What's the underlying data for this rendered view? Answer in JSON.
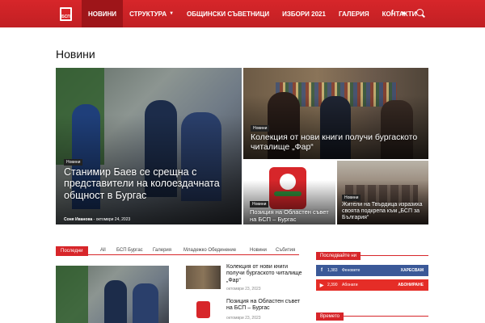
{
  "header": {
    "nav": [
      {
        "label": "НОВИНИ",
        "active": true
      },
      {
        "label": "СТРУКТУРА",
        "dropdown": true
      },
      {
        "label": "ОБЩИНСКИ СЪВЕТНИЦИ"
      },
      {
        "label": "ИЗБОРИ 2021"
      },
      {
        "label": "ГАЛЕРИЯ"
      },
      {
        "label": "КОНТАКТИ"
      }
    ],
    "logo_text": "БСП",
    "social": {
      "facebook": "f",
      "youtube": "▶"
    },
    "accent": "#d7262a"
  },
  "page_title": "Новини",
  "featured": [
    {
      "category": "Новини",
      "title": "Станимир Баев се срещна с представители на колоездачната общност в Бургас",
      "author": "Соня Иванова",
      "date": "октомври 24, 2023"
    },
    {
      "category": "Новини",
      "title": "Колекция от нови книги получи бургаското читалище „Фар“"
    },
    {
      "category": "Новини",
      "title": "Позиция на Областен съвет на БСП – Бургас"
    },
    {
      "category": "Новини",
      "title": "Жители на Твърдица изразиха своята подкрепа към „БСП за България“"
    }
  ],
  "tabs": {
    "first": "Последни",
    "items": [
      "All",
      "БСП Бургас",
      "Галерия",
      "Младежко Обединение",
      "Новини",
      "Събития"
    ]
  },
  "list": [
    {
      "title": "Колекция от нови книги получи бургаското читалище „Фар“",
      "date": "октомври 23, 2023"
    },
    {
      "title": "Позиция на Областен съвет на БСП – Бургас",
      "date": "октомври 23, 2023"
    }
  ],
  "sidebar": {
    "follow_title": "Последвайте ни",
    "facebook": {
      "count": "1,383",
      "label": "Феновете",
      "action": "ХАРЕСВАМ"
    },
    "youtube": {
      "count": "2,390",
      "label": "Абонати",
      "action": "АБОНИРАНЕ"
    },
    "weather_title": "Времето"
  }
}
